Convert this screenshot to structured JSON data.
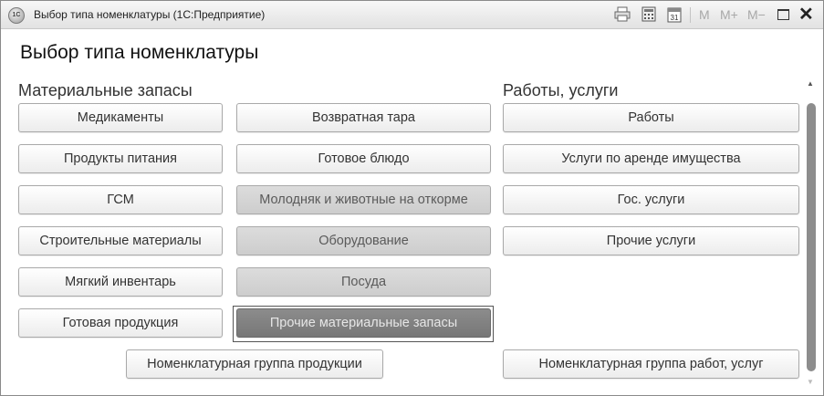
{
  "window": {
    "title": "Выбор типа номенклатуры  (1С:Предприятие)",
    "app_icon_text": "1С",
    "toolbar": {
      "print_icon": "printer-icon",
      "calc_icon": "calculator-icon",
      "calendar_icon": "calendar-icon",
      "calendar_label": "31",
      "mem_m": "M",
      "mem_plus": "M+",
      "mem_minus": "M−",
      "maximize_icon": "maximize-icon",
      "close_label": "✕"
    }
  },
  "form": {
    "title": "Выбор типа номенклатуры"
  },
  "groups": {
    "materials": {
      "title": "Материальные запасы",
      "col1": [
        "Медикаменты",
        "Продукты питания",
        "ГСМ",
        "Строительные материалы",
        "Мягкий инвентарь",
        "Готовая продукция"
      ],
      "col2": [
        "Возвратная тара",
        "Готовое блюдо",
        "Молодняк и животные на откорме",
        "Оборудование",
        "Посуда",
        "Прочие материальные запасы"
      ],
      "group_button": "Номенклатурная группа продукции"
    },
    "services": {
      "title": "Работы, услуги",
      "items": [
        "Работы",
        "Услуги по аренде имущества",
        "Гос. услуги",
        "Прочие услуги"
      ],
      "group_button": "Номенклатурная группа работ, услуг"
    }
  },
  "scroll": {
    "up": "▲",
    "down": "▼"
  },
  "colors": {
    "button_normal": "#ececec",
    "button_disabled": "#d4d4d4",
    "button_active": "#808080"
  }
}
